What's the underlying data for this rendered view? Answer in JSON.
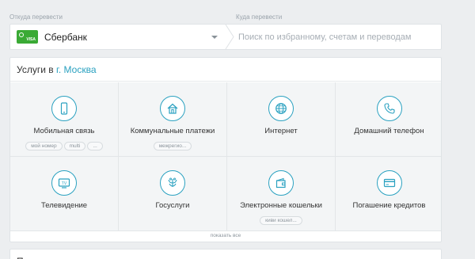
{
  "transfer": {
    "from_label": "Откуда перевести",
    "to_label": "Куда перевести",
    "card_brand": "VISA",
    "bank_name": "Сбербанк",
    "to_placeholder": "Поиск по избранному, счетам и переводам"
  },
  "services": {
    "title_prefix": "Услуги в",
    "city": "г. Москва",
    "items": [
      {
        "label": "Мобильная связь",
        "icon": "smartphone-icon",
        "tags": [
          "мой номер",
          "multi",
          "..."
        ]
      },
      {
        "label": "Коммунальные платежи",
        "icon": "house-icon",
        "tags": [
          "межрегио..."
        ]
      },
      {
        "label": "Интернет",
        "icon": "globe-icon",
        "tags": []
      },
      {
        "label": "Домашний телефон",
        "icon": "phone-handset-icon",
        "tags": []
      },
      {
        "label": "Телевидение",
        "icon": "tv-icon",
        "tags": []
      },
      {
        "label": "Госуслуги",
        "icon": "coat-of-arms-icon",
        "tags": []
      },
      {
        "label": "Электронные кошельки",
        "icon": "wallet-icon",
        "tags": [
          "киви кошел..."
        ]
      },
      {
        "label": "Погашение кредитов",
        "icon": "credit-card-icon",
        "tags": []
      }
    ],
    "show_all": "показать все"
  },
  "bottom": {
    "glyph": "П"
  },
  "colors": {
    "accent": "#2aa1c0",
    "card_green": "#3aaa35",
    "background": "#eceef0"
  }
}
